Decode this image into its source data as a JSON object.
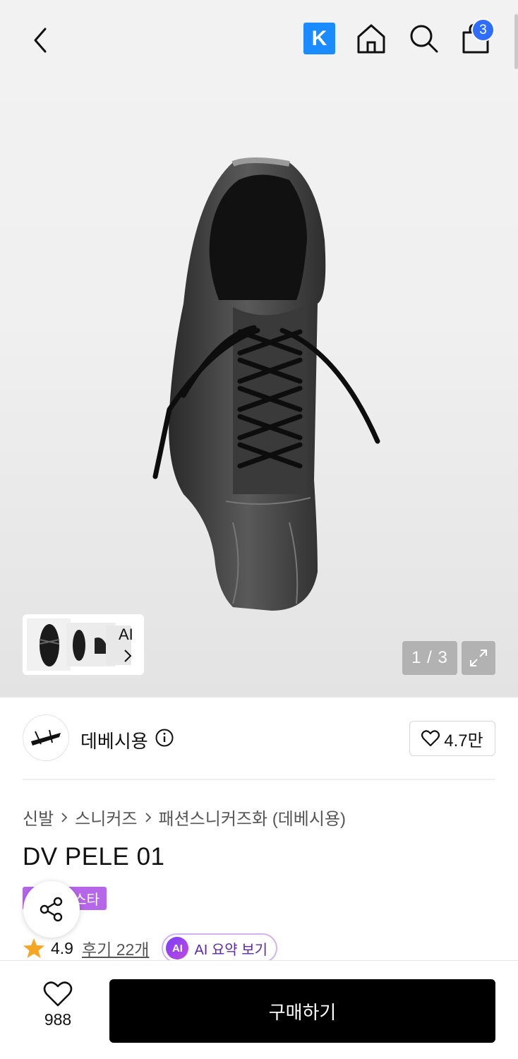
{
  "header": {
    "back_icon": "chevron-left-icon",
    "k_logo_text": "K",
    "cart_count": "3"
  },
  "gallery": {
    "counter": "1 / 3",
    "ai_label": "AI"
  },
  "brand": {
    "name": "데베시용",
    "likes": "4.7만"
  },
  "breadcrumb": {
    "items": [
      "신발",
      "스니커즈",
      "패션스니커즈화 (데베시용)"
    ]
  },
  "product": {
    "title": "DV PELE 01",
    "tag": "스타",
    "rating": "4.9",
    "review_link": "후기 22개",
    "ai_summary_icon": "AI",
    "ai_summary": "AI 요약 보기"
  },
  "bottom": {
    "wish_count": "988",
    "buy_label": "구매하기"
  },
  "colors": {
    "k_blue": "#1a8cff",
    "badge_blue": "#2f6dff",
    "tag_purple": "#b666e8",
    "star_orange": "#f5a623",
    "buy_black": "#000000"
  }
}
